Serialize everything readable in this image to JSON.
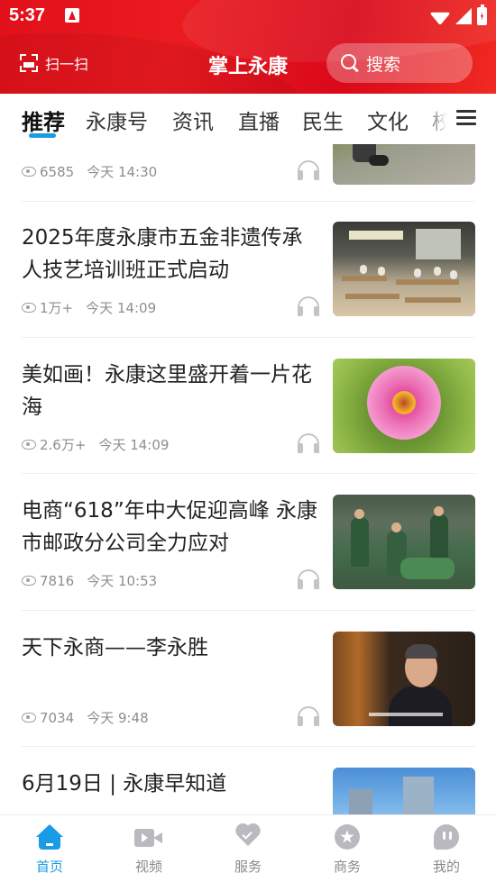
{
  "status_bar": {
    "time": "5:37"
  },
  "header": {
    "scan_label": "扫一扫",
    "title": "掌上永康",
    "search_label": "搜索"
  },
  "tabs": [
    {
      "label": "推荐",
      "active": true
    },
    {
      "label": "永康号"
    },
    {
      "label": "资讯"
    },
    {
      "label": "直播"
    },
    {
      "label": "民生"
    },
    {
      "label": "文化"
    },
    {
      "label": "校"
    }
  ],
  "articles": [
    {
      "title": "",
      "views": "6585",
      "time": "今天 14:30",
      "image": "path-with-person"
    },
    {
      "title": "2025年度永康市五金非遗传承人技艺培训班正式启动",
      "views": "1万+",
      "time": "今天 14:09",
      "image": "classroom-training"
    },
    {
      "title": "美如画！永康这里盛开着一片花海",
      "views": "2.6万+",
      "time": "今天 14:09",
      "image": "pink-flower"
    },
    {
      "title": "电商“618”年中大促迎高峰 永康市邮政分公司全力应对",
      "views": "7816",
      "time": "今天 10:53",
      "image": "postal-workers"
    },
    {
      "title": "天下永商——李永胜",
      "views": "7034",
      "time": "今天 9:48",
      "image": "interview-man"
    },
    {
      "title": "6月19日 | 永康早知道",
      "views": "",
      "time": "",
      "image": "city-buildings"
    }
  ],
  "bottom_nav": [
    {
      "label": "首页",
      "icon": "home-icon",
      "active": true
    },
    {
      "label": "视频",
      "icon": "video-icon"
    },
    {
      "label": "服务",
      "icon": "service-heart-icon"
    },
    {
      "label": "商务",
      "icon": "business-star-icon"
    },
    {
      "label": "我的",
      "icon": "profile-icon"
    }
  ],
  "colors": {
    "header_red": "#e1101a",
    "accent_blue": "#1a9be6",
    "meta_gray": "#8e8e8e"
  }
}
